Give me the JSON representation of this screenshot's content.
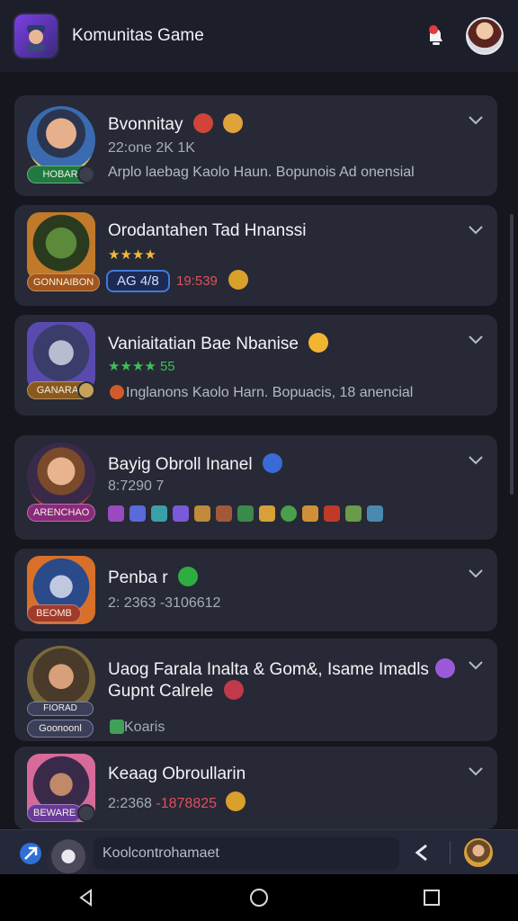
{
  "header": {
    "title": "Komunitas Game",
    "logo_icon": "game-logo-icon",
    "notification_icon": "notification-icon",
    "avatar_icon": "user-avatar"
  },
  "feed": [
    {
      "title": "Bvonnitay",
      "meta": "22:one 2K 1K",
      "description": "Arplo laebag Kaolo Haun. Bopunois Ad onensial",
      "level_badge": "HOBAR",
      "badge_color": "#1f7a3f"
    },
    {
      "title": "Orodantahen Tad Hnanssi",
      "meta": "★★★★",
      "tag": "AG 4/8",
      "count": "19:539",
      "level_badge": "GONNAIBON",
      "badge_color": "#a4551a"
    },
    {
      "title": "Vaniaitatian Bae Nbanise",
      "meta": "★★★★ 55",
      "description": "Inglanons Kaolo Harn. Bopuacis, 18 anencial",
      "level_badge": "GANARAL",
      "badge_color": "#8a5a1c"
    },
    {
      "title": "Bayig Obroll Inanel",
      "meta": "8:7290 7",
      "level_badge": "ARENCHAO",
      "badge_color": "#8a2a7a"
    },
    {
      "title": "Penba r",
      "meta": "2: 2363 -3106612",
      "level_badge": "BEOMB",
      "badge_color": "#a03a2a"
    },
    {
      "title": "Uaog Farala Inalta & Gom&, Isame Imadls",
      "title2": "Gupnt Calrele",
      "meta": "Koaris",
      "level_badge": "FIORAD",
      "badge_color": "#3b3f5a",
      "level_badge2": "Goonoonl"
    },
    {
      "title": "Keaag Obroullarin",
      "meta": "2:2368",
      "count": "-1878825",
      "level_badge": "BEWARE",
      "badge_color": "#6a3a9a"
    }
  ],
  "composer": {
    "placeholder": "Koolcontrohamaet",
    "send_icon": "send-icon",
    "back_icon": "chevron-left-icon"
  },
  "navigation": {
    "back": "back-triangle-icon",
    "home": "home-circle-icon",
    "recent": "recent-square-icon"
  }
}
